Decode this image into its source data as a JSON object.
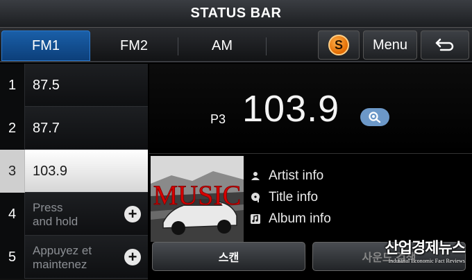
{
  "status_bar": {
    "title": "STATUS BAR"
  },
  "tabs": [
    {
      "label": "FM1",
      "active": true
    },
    {
      "label": "FM2",
      "active": false
    },
    {
      "label": "AM",
      "active": false
    }
  ],
  "toolbar": {
    "sound_icon": "soundhound-icon",
    "menu_label": "Menu",
    "back_icon": "back-arrow-icon"
  },
  "presets": [
    {
      "number": "1",
      "frequency": "87.5"
    },
    {
      "number": "2",
      "frequency": "87.7"
    },
    {
      "number": "3",
      "frequency": "103.9",
      "selected": true
    },
    {
      "number": "4",
      "hint": "Press\nand hold"
    },
    {
      "number": "5",
      "hint": "Appuyez et\nmaintenez"
    }
  ],
  "now_playing": {
    "preset_label": "P3",
    "frequency": "103.9",
    "album_art_text": "MUSIC",
    "artist": "Artist info",
    "title": "Title info",
    "album": "Album info"
  },
  "bottom_buttons": {
    "scan": "스캔",
    "second": "사운드 검색"
  },
  "watermark": {
    "korean": "산업경제뉴스",
    "english": "Industrial Economic Fact Reviews"
  },
  "colors": {
    "accent_tab": "#1a5fa8",
    "search_badge": "#6c98c8",
    "sound_icon": "#e26a00"
  }
}
